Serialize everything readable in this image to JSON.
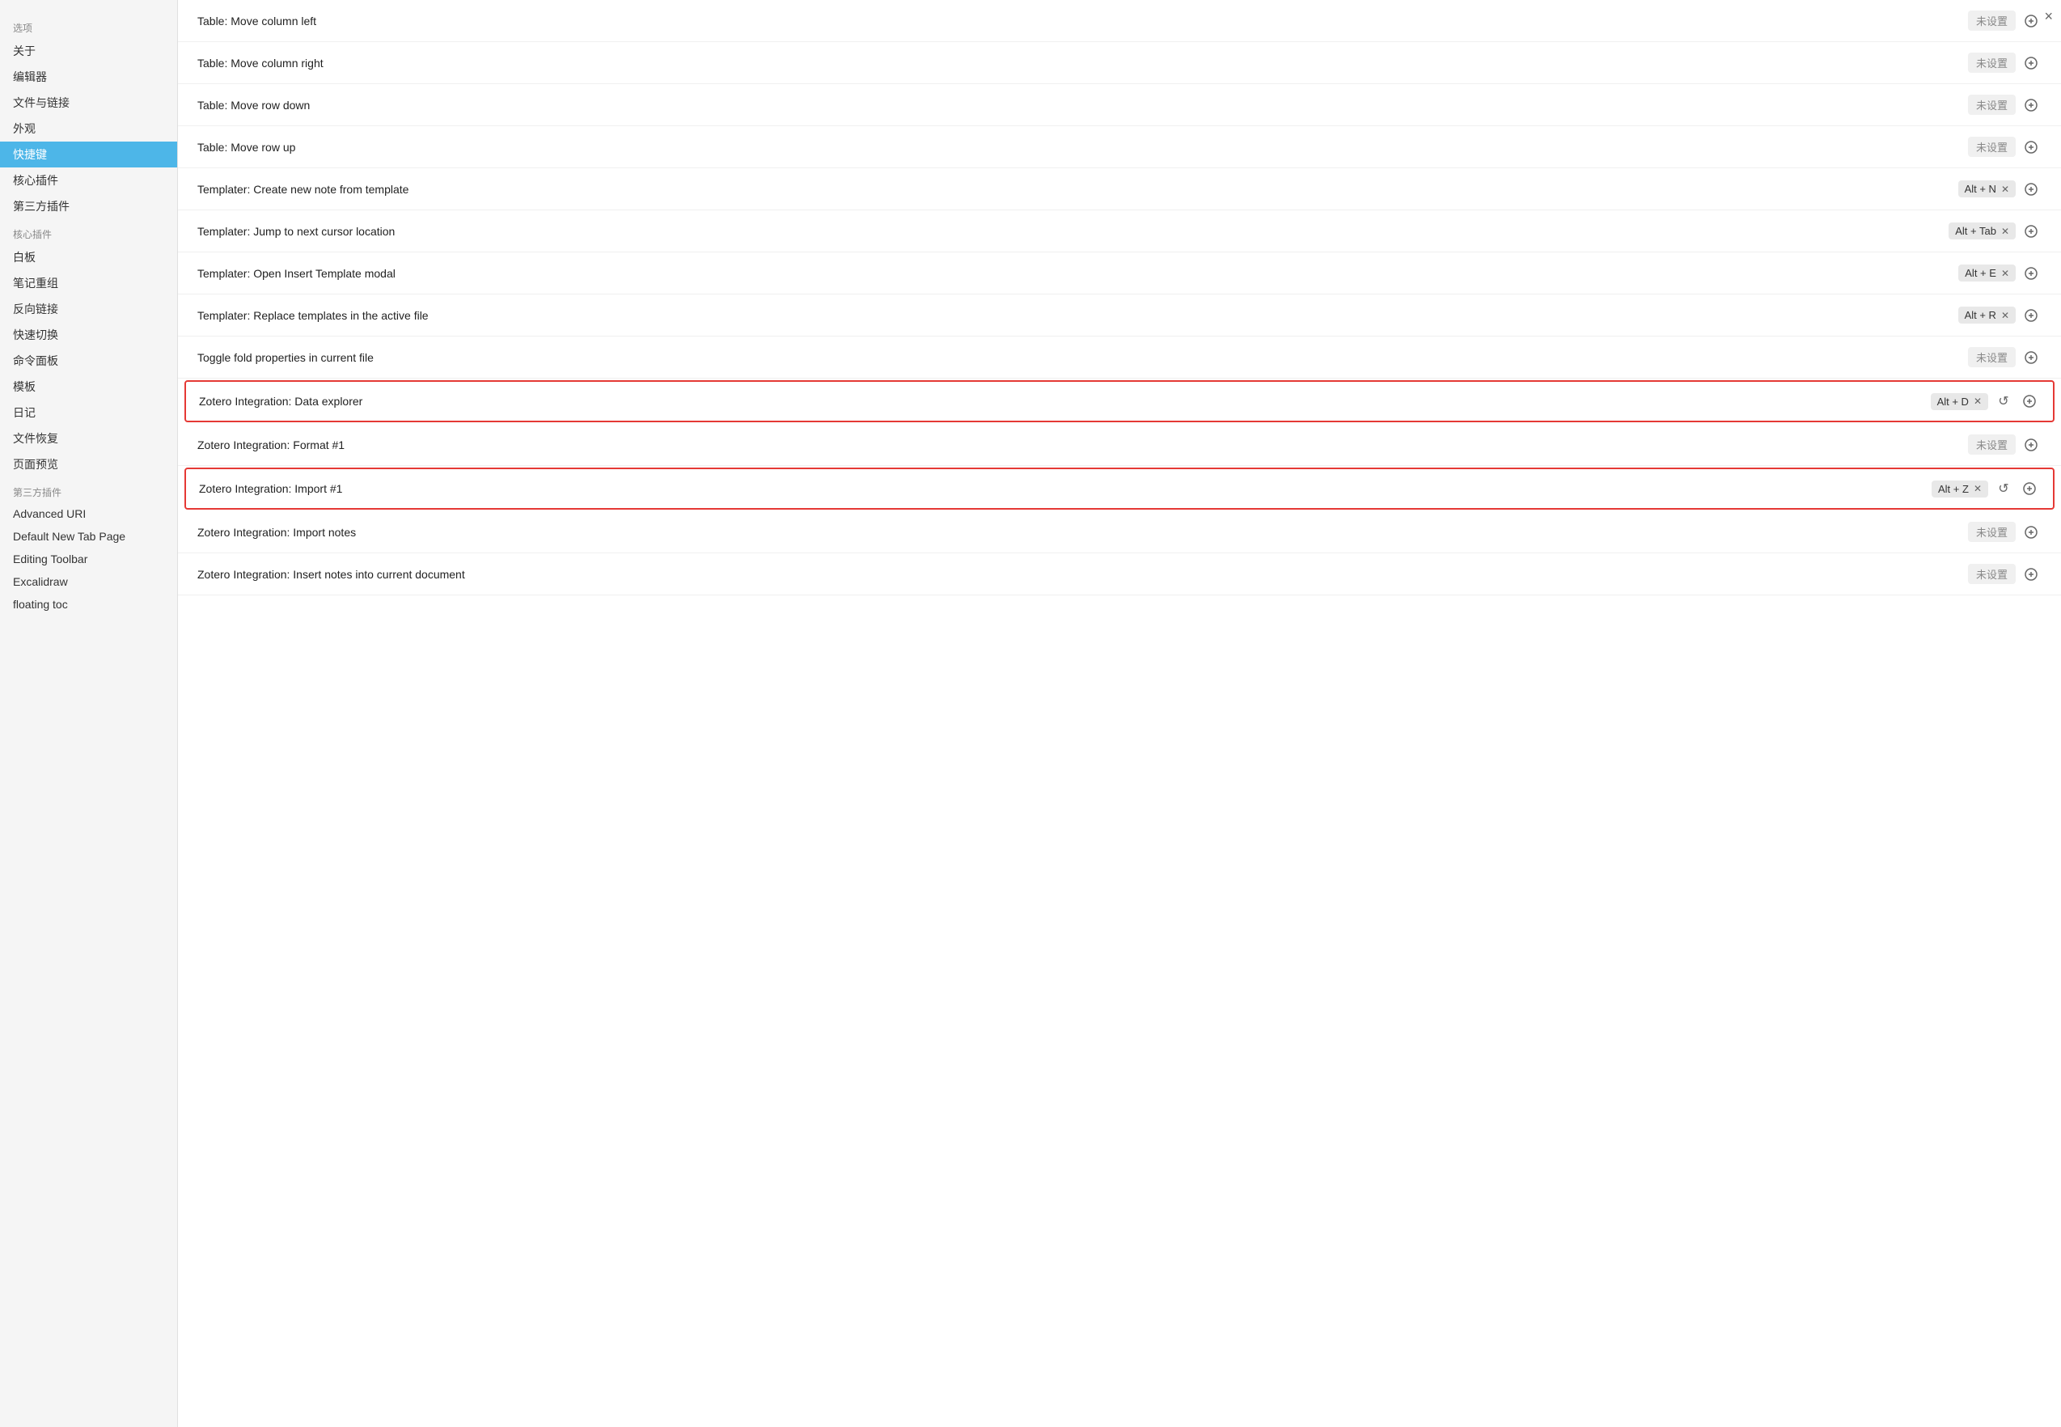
{
  "sidebar": {
    "section1_label": "选项",
    "items_top": [
      {
        "label": "关于",
        "active": false
      },
      {
        "label": "编辑器",
        "active": false
      },
      {
        "label": "文件与链接",
        "active": false
      },
      {
        "label": "外观",
        "active": false
      },
      {
        "label": "快捷键",
        "active": true
      },
      {
        "label": "核心插件",
        "active": false
      },
      {
        "label": "第三方插件",
        "active": false
      }
    ],
    "section2_label": "核心插件",
    "items_core": [
      {
        "label": "白板",
        "active": false
      },
      {
        "label": "笔记重组",
        "active": false
      },
      {
        "label": "反向链接",
        "active": false
      },
      {
        "label": "快速切换",
        "active": false
      },
      {
        "label": "命令面板",
        "active": false
      },
      {
        "label": "模板",
        "active": false
      },
      {
        "label": "日记",
        "active": false
      },
      {
        "label": "文件恢复",
        "active": false
      },
      {
        "label": "页面预览",
        "active": false
      }
    ],
    "section3_label": "第三方插件",
    "items_third": [
      {
        "label": "Advanced URI",
        "active": false
      },
      {
        "label": "Default New Tab Page",
        "active": false
      },
      {
        "label": "Editing Toolbar",
        "active": false
      },
      {
        "label": "Excalidraw",
        "active": false
      },
      {
        "label": "floating toc",
        "active": false
      }
    ]
  },
  "hotkeys": [
    {
      "name": "Table: Move column left",
      "shortcut": null,
      "unset": true,
      "highlighted": false
    },
    {
      "name": "Table: Move column right",
      "shortcut": null,
      "unset": true,
      "highlighted": false
    },
    {
      "name": "Table: Move row down",
      "shortcut": null,
      "unset": true,
      "highlighted": false
    },
    {
      "name": "Table: Move row up",
      "shortcut": null,
      "unset": true,
      "highlighted": false
    },
    {
      "name": "Templater: Create new note from template",
      "shortcut": "Alt + N",
      "unset": false,
      "highlighted": false
    },
    {
      "name": "Templater: Jump to next cursor location",
      "shortcut": "Alt + Tab",
      "unset": false,
      "highlighted": false
    },
    {
      "name": "Templater: Open Insert Template modal",
      "shortcut": "Alt + E",
      "unset": false,
      "highlighted": false
    },
    {
      "name": "Templater: Replace templates in the active file",
      "shortcut": "Alt + R",
      "unset": false,
      "highlighted": false
    },
    {
      "name": "Toggle fold properties in current file",
      "shortcut": null,
      "unset": true,
      "highlighted": false
    },
    {
      "name": "Zotero Integration: Data explorer",
      "shortcut": "Alt + D",
      "unset": false,
      "highlighted": true,
      "show_reset": true
    },
    {
      "name": "Zotero Integration: Format #1",
      "shortcut": null,
      "unset": true,
      "highlighted": false
    },
    {
      "name": "Zotero Integration: Import #1",
      "shortcut": "Alt + Z",
      "unset": false,
      "highlighted": true,
      "show_reset": true
    },
    {
      "name": "Zotero Integration: Import notes",
      "shortcut": null,
      "unset": true,
      "highlighted": false
    },
    {
      "name": "Zotero Integration: Insert notes into current document",
      "shortcut": null,
      "unset": true,
      "highlighted": false
    }
  ],
  "labels": {
    "unset": "未设置",
    "panel_close": "×"
  }
}
